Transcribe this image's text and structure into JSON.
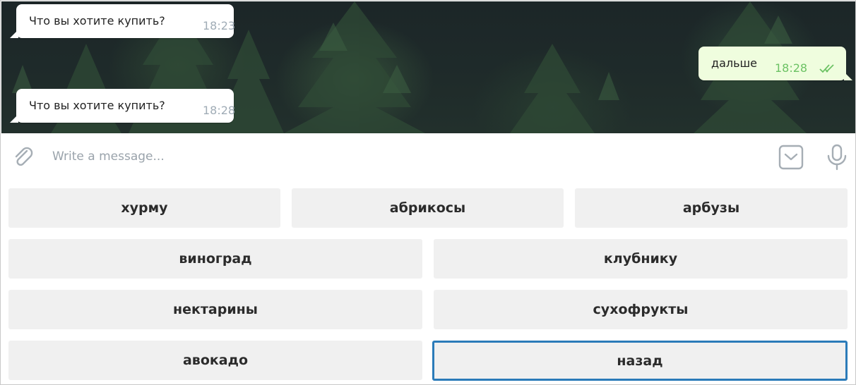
{
  "messages": [
    {
      "direction": "in",
      "text": "Что вы хотите купить?",
      "time": "18:23"
    },
    {
      "direction": "out",
      "text": "дальше",
      "time": "18:28",
      "status": "read"
    },
    {
      "direction": "in",
      "text": "Что вы хотите купить?",
      "time": "18:28"
    }
  ],
  "composer": {
    "placeholder": "Write a message...",
    "attach_icon": "paperclip-icon",
    "keyboard_icon": "keyboard-toggle-icon",
    "mic_icon": "microphone-icon"
  },
  "keyboard": {
    "rows": [
      [
        "хурму",
        "абрикосы",
        "арбузы"
      ],
      [
        "виноград",
        "клубнику"
      ],
      [
        "нектарины",
        "сухофрукты"
      ],
      [
        "авокадо",
        "назад"
      ]
    ],
    "focused": "назад"
  },
  "colors": {
    "outgoing_bubble": "#effdde",
    "outgoing_time": "#6cc264",
    "incoming_time": "#a0acb6",
    "button_bg": "#f0f0f0",
    "focus_border": "#2b7bb9"
  }
}
